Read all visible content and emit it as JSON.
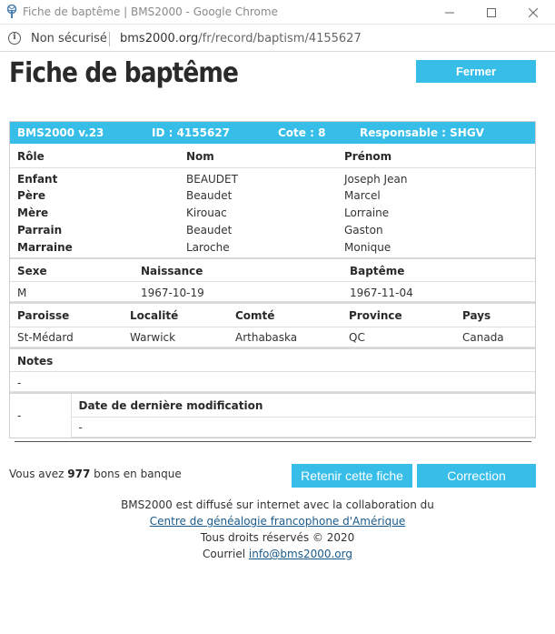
{
  "browser": {
    "window_title": "Fiche de baptême | BMS2000 - Google Chrome",
    "security_label": "Non sécurisé",
    "url_host": "bms2000.org",
    "url_path": "/fr/record/baptism/4155627"
  },
  "page": {
    "title": "Fiche de baptême",
    "close_label": "Fermer"
  },
  "record": {
    "header": {
      "version": "BMS2000 v.23",
      "id": "ID : 4155627",
      "cote": "Cote : 8",
      "responsable": "Responsable : SHGV"
    },
    "people_headers": [
      "Rôle",
      "Nom",
      "Prénom"
    ],
    "people": [
      {
        "role": "Enfant",
        "nom": "BEAUDET",
        "prenom": "Joseph Jean"
      },
      {
        "role": "Père",
        "nom": "Beaudet",
        "prenom": "Marcel"
      },
      {
        "role": "Mère",
        "nom": "Kirouac",
        "prenom": "Lorraine"
      },
      {
        "role": "Parrain",
        "nom": "Beaudet",
        "prenom": "Gaston"
      },
      {
        "role": "Marraine",
        "nom": "Laroche",
        "prenom": "Monique"
      }
    ],
    "dates_headers": [
      "Sexe",
      "Naissance",
      "Baptême"
    ],
    "dates": {
      "sexe": "M",
      "naissance": "1967-10-19",
      "bapteme": "1967-11-04"
    },
    "place_headers": [
      "Paroisse",
      "Localité",
      "Comté",
      "Province",
      "Pays"
    ],
    "place": {
      "paroisse": "St-Médard",
      "localite": "Warwick",
      "comte": "Arthabaska",
      "province": "QC",
      "pays": "Canada"
    },
    "notes_header": "Notes",
    "notes": "-",
    "mod_left": "-",
    "mod_header": "Date de dernière modification",
    "mod_value": "-"
  },
  "bank": {
    "prefix": "Vous avez",
    "count": "977",
    "suffix": "bons en banque"
  },
  "actions": {
    "retain_label": "Retenir cette fiche",
    "correction_label": "Correction"
  },
  "footer": {
    "line1": "BMS2000 est diffusé sur internet avec la collaboration du",
    "link1": "Centre de généalogie francophone d'Amérique",
    "line3": "Tous droits réservés © 2020",
    "line4_prefix": "Courriel",
    "email": "info@bms2000.org"
  },
  "colors": {
    "accent": "#36bde8"
  }
}
